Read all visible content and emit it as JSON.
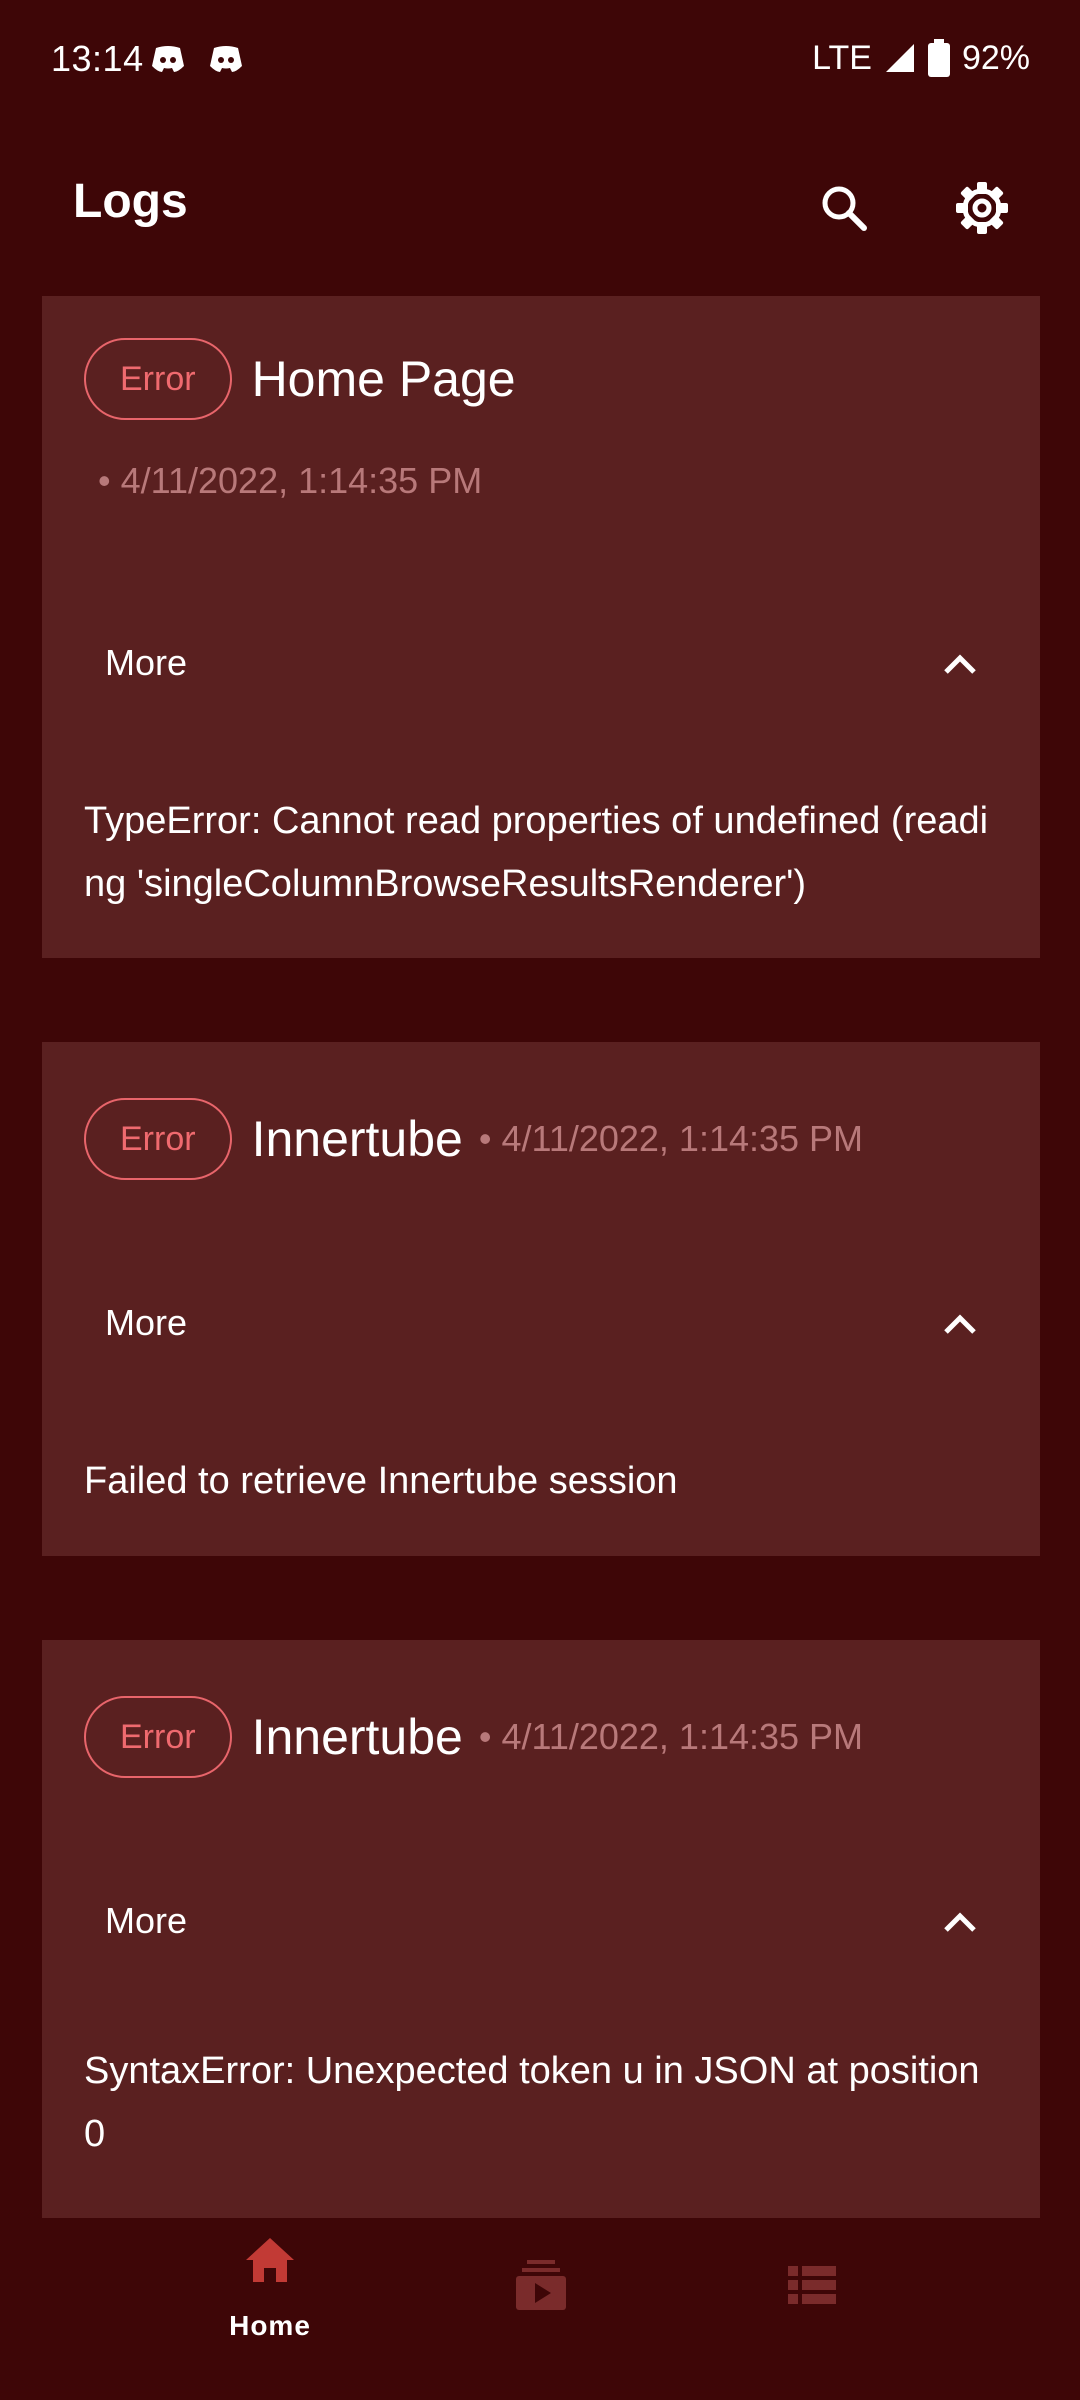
{
  "status_bar": {
    "time": "13:14",
    "network": "LTE",
    "battery": "92%"
  },
  "app_bar": {
    "title": "Logs",
    "icons": [
      "search-icon",
      "settings-icon"
    ]
  },
  "logs": [
    {
      "level": "Error",
      "source": "Home Page",
      "timestamp": "• 4/11/2022, 1:14:35 PM",
      "more_label": "More",
      "message": "TypeError: Cannot read properties of undefined (reading 'singleColumnBrowseResultsRenderer')"
    },
    {
      "level": "Error",
      "source": "Innertube",
      "timestamp": "• 4/11/2022, 1:14:35 PM",
      "more_label": "More",
      "message": "Failed to retrieve Innertube session"
    },
    {
      "level": "Error",
      "source": "Innertube",
      "timestamp": "• 4/11/2022, 1:14:35 PM",
      "more_label": "More",
      "message": "SyntaxError: Unexpected token u in JSON at position 0"
    }
  ],
  "bottom_nav": {
    "items": [
      {
        "label": "Home",
        "icon": "home-icon",
        "active": true
      },
      {
        "label": "",
        "icon": "subscriptions-icon",
        "active": false
      },
      {
        "label": "",
        "icon": "list-icon",
        "active": false
      }
    ]
  },
  "colors": {
    "background": "#3e0607",
    "card": "#5a2020",
    "error_accent": "#ef6a6f",
    "meta_text": "#b8797a",
    "nav_active": "#c23a35",
    "nav_inactive": "#7a2b2b"
  }
}
